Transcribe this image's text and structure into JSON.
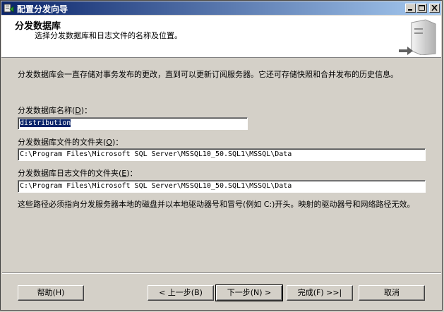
{
  "window": {
    "title": "配置分发向导",
    "controls": {
      "minimize": "minimize",
      "maximize": "maximize",
      "close": "close"
    }
  },
  "header": {
    "title": "分发数据库",
    "subtitle": "选择分发数据库和日志文件的名称及位置。"
  },
  "description": "分发数据库会一直存储对事务发布的更改，直到可以更新订阅服务器。它还可存储快照和合并发布的历史信息。",
  "db_name": {
    "label_pre": "分发数据库名称(",
    "label_key": "D",
    "label_post": ")：",
    "value": "distribution"
  },
  "data_folder": {
    "label_pre": "分发数据库文件的文件夹(",
    "label_key": "O",
    "label_post": ")：",
    "value": "C:\\Program Files\\Microsoft SQL Server\\MSSQL10_50.SQL1\\MSSQL\\Data"
  },
  "log_folder": {
    "label_pre": "分发数据库日志文件的文件夹(",
    "label_key": "E",
    "label_post": ")：",
    "value": "C:\\Program Files\\Microsoft SQL Server\\MSSQL10_50.SQL1\\MSSQL\\Data"
  },
  "note": "这些路径必须指向分发服务器本地的磁盘并以本地驱动器号和冒号(例如 C:)开头。映射的驱动器号和网络路径无效。",
  "buttons": {
    "help": "帮助(H)",
    "back": "< 上一步(B)",
    "next": "下一步(N) >",
    "finish": "完成(F) >>|",
    "cancel": "取消"
  }
}
